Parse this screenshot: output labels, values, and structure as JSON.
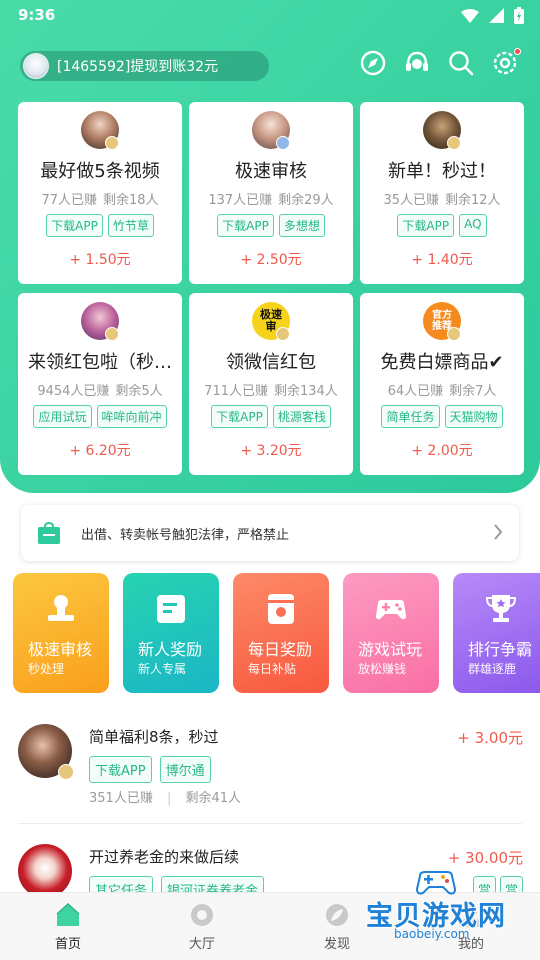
{
  "status_bar": {
    "time": "9:36"
  },
  "header": {
    "notice": "[1465592]提现到账32元"
  },
  "task_cards": [
    {
      "title": "最好做5条视频",
      "earned": "77人已赚",
      "remaining": "剩余18人",
      "tags": [
        "下载APP",
        "竹节草"
      ],
      "reward": "+ 1.50元"
    },
    {
      "title": "极速审核",
      "earned": "137人已赚",
      "remaining": "剩余29人",
      "tags": [
        "下载APP",
        "多想想"
      ],
      "reward": "+ 2.50元"
    },
    {
      "title": "新单！秒过！",
      "earned": "35人已赚",
      "remaining": "剩余12人",
      "tags": [
        "下载APP",
        "AQ"
      ],
      "reward": "+ 1.40元"
    },
    {
      "title": "来领红包啦（秒…",
      "earned": "9454人已赚",
      "remaining": "剩余5人",
      "tags": [
        "应用试玩",
        "哞哞向前冲"
      ],
      "reward": "+ 6.20元"
    },
    {
      "title": "领微信红包",
      "earned": "711人已赚",
      "remaining": "剩余134人",
      "tags": [
        "下载APP",
        "桃源客栈"
      ],
      "reward": "+ 3.20元",
      "avatar_text": "极速 审"
    },
    {
      "title": "免费白嫖商品✔",
      "earned": "64人已赚",
      "remaining": "剩余7人",
      "tags": [
        "简单任务",
        "天猫购物"
      ],
      "reward": "+ 2.00元",
      "avatar_text": "官方 推荐"
    }
  ],
  "warning": {
    "text": "出借、转卖帐号触犯法律，严格禁止"
  },
  "categories": [
    {
      "title": "极速审核",
      "subtitle": "秒处理",
      "color": "#fbb52c",
      "icon": "stamp-icon"
    },
    {
      "title": "新人奖励",
      "subtitle": "新人专属",
      "color": "#22c7b8",
      "icon": "card-icon"
    },
    {
      "title": "每日奖励",
      "subtitle": "每日补贴",
      "color": "#fb6f55",
      "icon": "bag-icon"
    },
    {
      "title": "游戏试玩",
      "subtitle": "放松赚钱",
      "color": "#fc84b0",
      "icon": "gamepad-icon"
    },
    {
      "title": "排行争霸",
      "subtitle": "群雄逐鹿",
      "color": "#a06ef3",
      "icon": "trophy-icon"
    }
  ],
  "list_items": [
    {
      "title": "简单福利8条，秒过",
      "reward": "+ 3.00元",
      "tags": [
        "下载APP",
        "博尔通"
      ],
      "earned": "351人已赚",
      "separator": "|",
      "remaining": "剩余41人"
    },
    {
      "title": "开过养老金的来做后续",
      "reward": "+ 30.00元",
      "tags": [
        "其它任务",
        "银河证券养老金"
      ],
      "extra_tags": [
        "赏",
        "赏"
      ]
    }
  ],
  "tabs": [
    {
      "label": "首页",
      "active": true
    },
    {
      "label": "大厅",
      "active": false
    },
    {
      "label": "发现",
      "active": false
    },
    {
      "label": "我的",
      "active": false
    }
  ],
  "watermark": {
    "title": "宝贝游戏网",
    "url": "baobeiy.com"
  }
}
